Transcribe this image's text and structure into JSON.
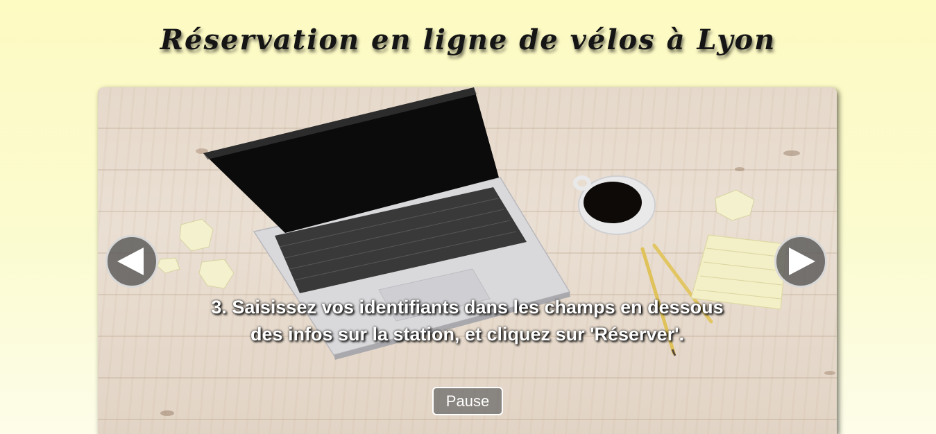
{
  "page": {
    "title": "Réservation en ligne de vélos à Lyon"
  },
  "slider": {
    "caption": "3. Saisissez vos identifiants dans les champs en dessous des infos sur la station, et cliquez sur 'Réserver'.",
    "pause_label": "Pause",
    "prev_icon": "arrow-left-icon",
    "next_icon": "arrow-right-icon",
    "image_subject": "laptop-on-wooden-desk-with-coffee-and-pencils"
  },
  "colors": {
    "background_top": "#fdfac2",
    "background_bottom": "#fdfde9",
    "title_text": "#151515",
    "caption_text": "#ffffff",
    "button_bg": "#5f5f5f"
  }
}
